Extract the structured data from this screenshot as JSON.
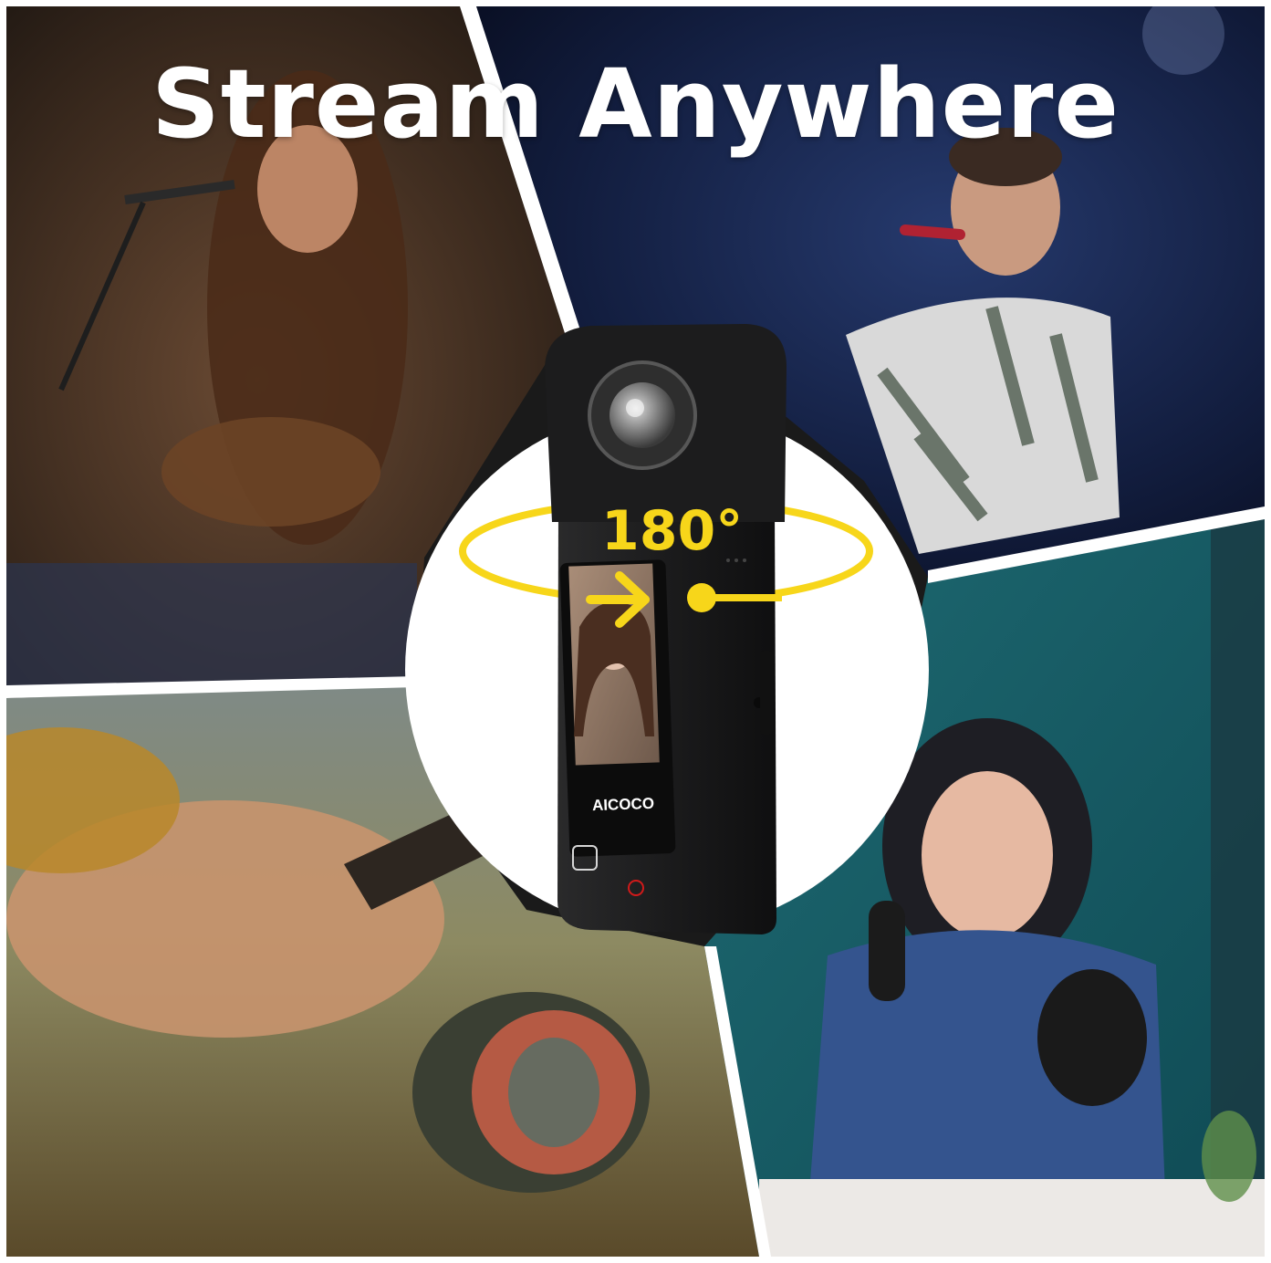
{
  "headline": "Stream Anywhere",
  "rotation_label": "180°",
  "camera_brand": "AICOCO",
  "colors": {
    "accent_yellow": "#f7d61a",
    "panel_divider": "#ffffff",
    "camera_body": "#1b1b1c"
  },
  "scenes": [
    {
      "name": "singer-with-guitar"
    },
    {
      "name": "singer-on-stage"
    },
    {
      "name": "fishing-reel"
    },
    {
      "name": "podcaster-with-headphones"
    }
  ],
  "icons": [
    "camera-lens-icon",
    "selfie-screen-icon",
    "record-button-icon",
    "mode-button-icon",
    "rotation-arrow-icon"
  ]
}
